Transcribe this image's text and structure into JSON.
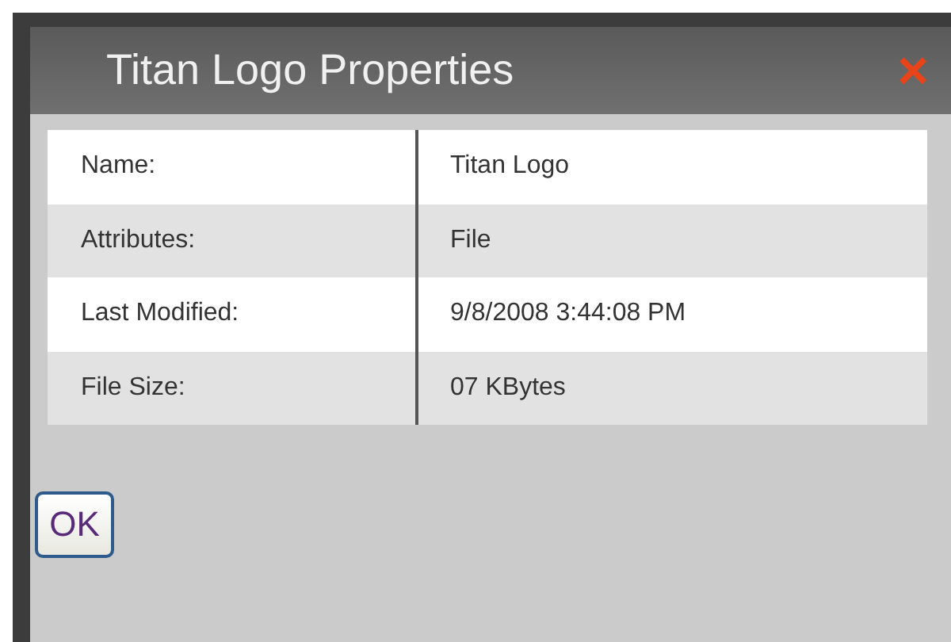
{
  "window": {
    "title": "Titan Logo Properties",
    "close": "×"
  },
  "properties": [
    {
      "label": "Name:",
      "value": "Titan Logo"
    },
    {
      "label": "Attributes:",
      "value": "File"
    },
    {
      "label": "Last Modified:",
      "value": "9/8/2008 3:44:08 PM"
    },
    {
      "label": "File Size:",
      "value": "07 KBytes"
    }
  ],
  "buttons": [
    "OK"
  ]
}
